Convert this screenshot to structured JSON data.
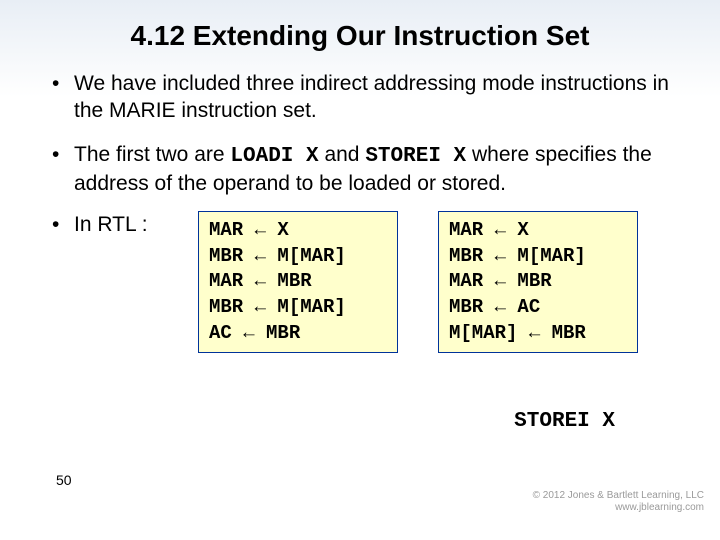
{
  "title": "4.12 Extending Our Instruction Set",
  "bullets": [
    "We have included three indirect addressing mode instructions in the MARIE instruction set."
  ],
  "bullets_rich": {
    "1": {
      "a": "The first two are ",
      "code1": "LOADI X",
      "b": " and ",
      "code2": "STOREI X",
      "c": " where specifies the address of the operand to be loaded or stored."
    }
  },
  "rtl_label": "In RTL :",
  "rtl_boxes": [
    "MAR ← X\nMBR ← M[MAR]\nMAR ← MBR\nMBR ← M[MAR]\nAC ← MBR",
    "MAR ← X\nMBR ← M[MAR]\nMAR ← MBR\nMBR ← AC\nM[MAR] ← MBR"
  ],
  "storei_caption": "STOREI X",
  "page_number": "50",
  "copyright": {
    "line1": "© 2012 Jones & Bartlett Learning, LLC",
    "line2": "www.jblearning.com"
  }
}
